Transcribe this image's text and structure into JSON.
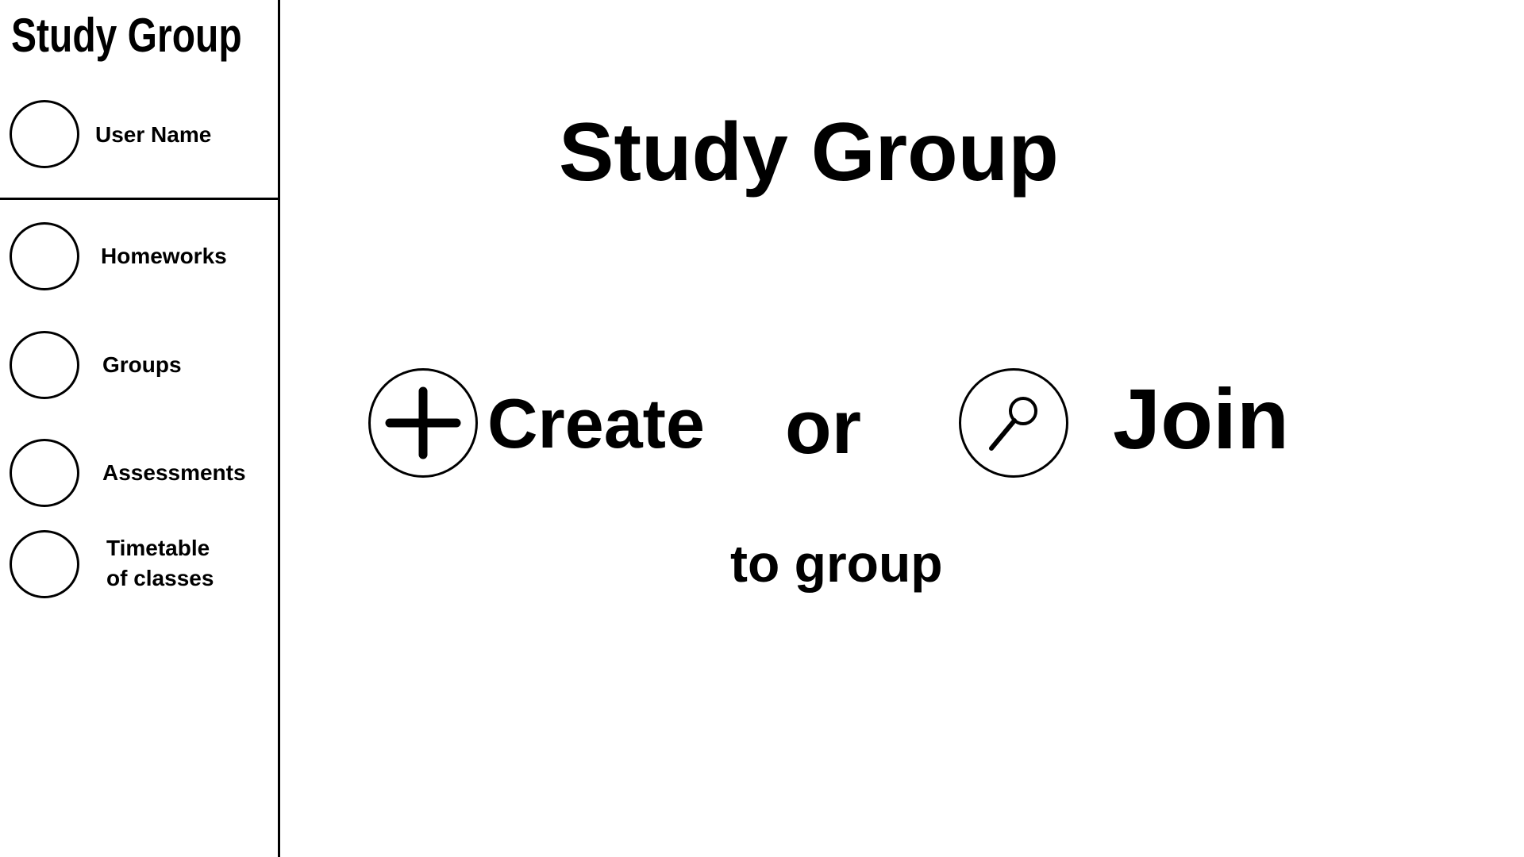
{
  "sidebar": {
    "brand": "Study Group",
    "user_name": "User Name",
    "items": [
      {
        "label": "Homeworks"
      },
      {
        "label": "Groups"
      },
      {
        "label": "Assessments"
      },
      {
        "label_line1": "Timetable",
        "label_line2": "of classes"
      }
    ]
  },
  "main": {
    "title": "Study Group",
    "create_label": "Create",
    "or_label": "or",
    "join_label": "Join",
    "subtitle": "to group",
    "icons": {
      "create": "plus-icon",
      "join": "search-icon"
    }
  }
}
